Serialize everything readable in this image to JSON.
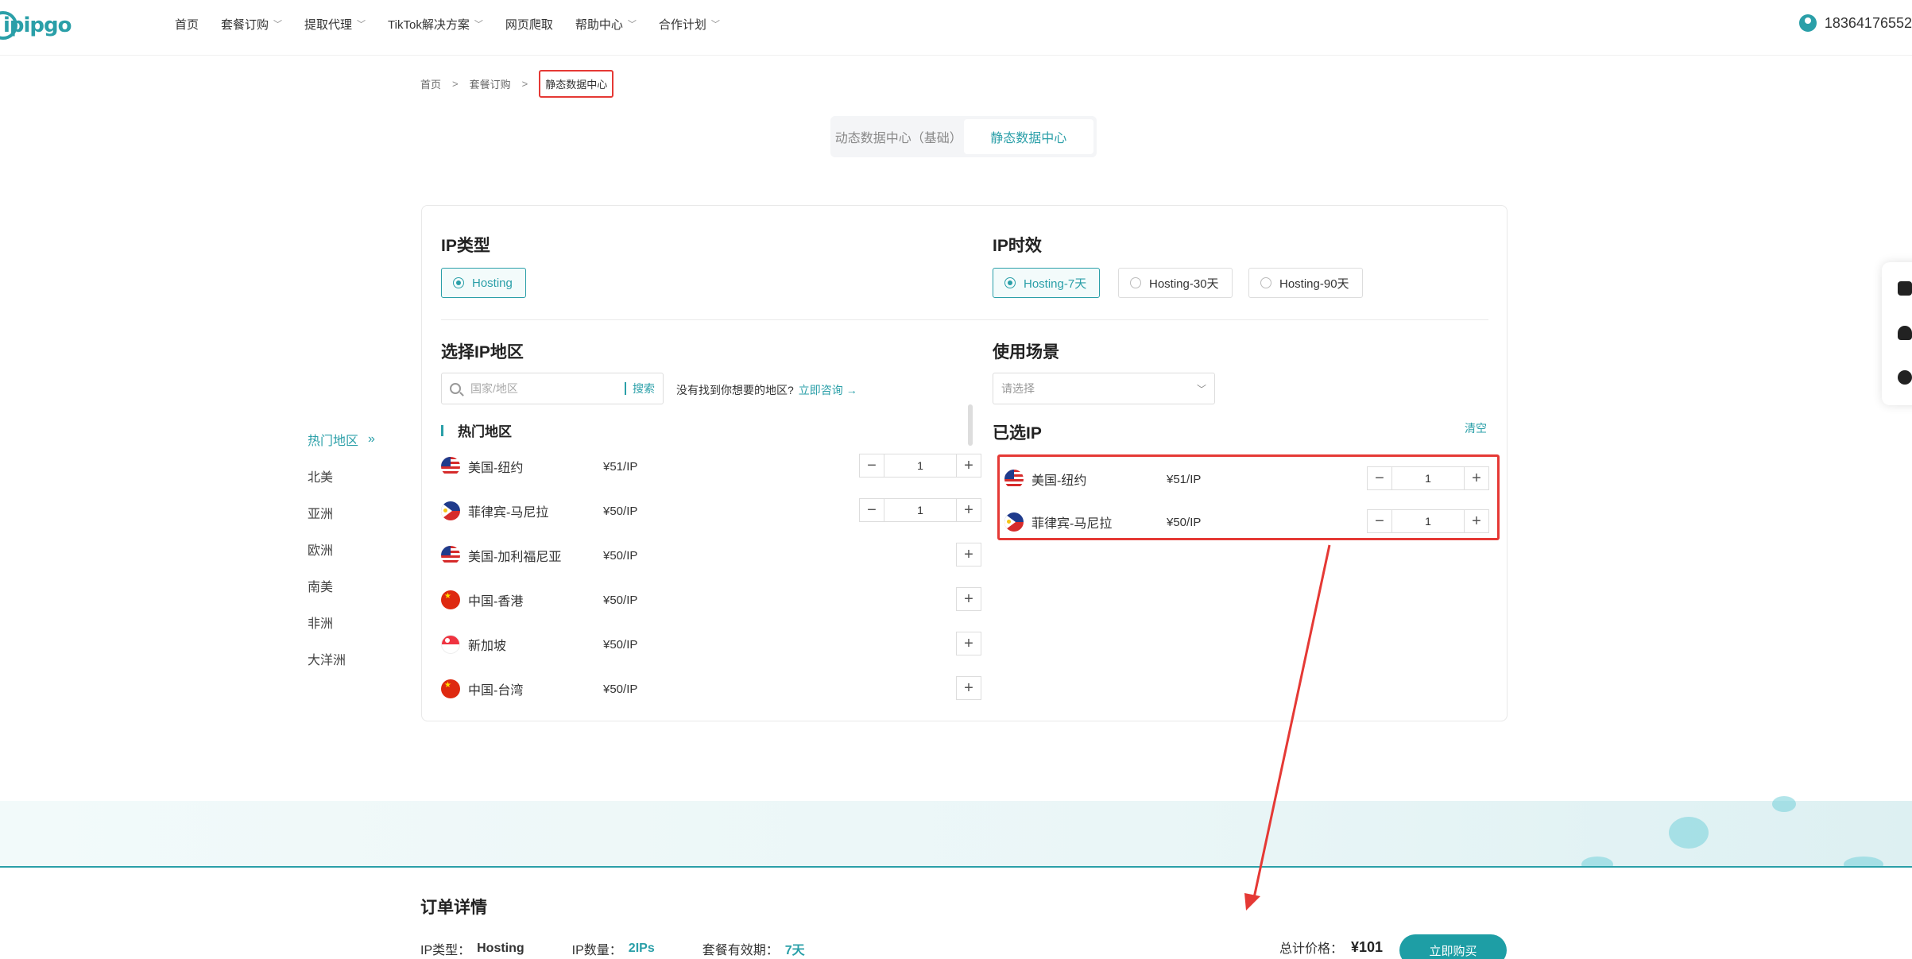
{
  "header": {
    "logo": "ipipgo",
    "nav": [
      {
        "label": "首页",
        "dropdown": false
      },
      {
        "label": "套餐订购",
        "dropdown": true
      },
      {
        "label": "提取代理",
        "dropdown": true
      },
      {
        "label": "TikTok解决方案",
        "dropdown": true
      },
      {
        "label": "网页爬取",
        "dropdown": false
      },
      {
        "label": "帮助中心",
        "dropdown": true
      },
      {
        "label": "合作计划",
        "dropdown": true
      }
    ],
    "user_phone": "18364176552"
  },
  "breadcrumb": {
    "home": "首页",
    "sep": ">",
    "middle": "套餐订购",
    "current": "静态数据中心"
  },
  "tabs": [
    {
      "label": "动态数据中心（基础）",
      "active": false
    },
    {
      "label": "静态数据中心",
      "active": true
    }
  ],
  "regions": [
    {
      "label": "热门地区",
      "active": true
    },
    {
      "label": "北美",
      "active": false
    },
    {
      "label": "亚洲",
      "active": false
    },
    {
      "label": "欧洲",
      "active": false
    },
    {
      "label": "南美",
      "active": false
    },
    {
      "label": "非洲",
      "active": false
    },
    {
      "label": "大洋洲",
      "active": false
    }
  ],
  "ip_type": {
    "title": "IP类型",
    "options": [
      {
        "label": "Hosting",
        "selected": true
      }
    ]
  },
  "ip_duration": {
    "title": "IP时效",
    "options": [
      {
        "label": "Hosting-7天",
        "selected": true
      },
      {
        "label": "Hosting-30天",
        "selected": false
      },
      {
        "label": "Hosting-90天",
        "selected": false
      }
    ]
  },
  "region_select": {
    "title": "选择IP地区",
    "search_placeholder": "国家/地区",
    "search_button": "搜索",
    "hint": "没有找到你想要的地区?",
    "consult_link": "立即咨询",
    "hot_title": "热门地区",
    "items": [
      {
        "flag": "us",
        "name": "美国-纽约",
        "price": "¥51/IP",
        "qty": "1",
        "selected": true
      },
      {
        "flag": "ph",
        "name": "菲律宾-马尼拉",
        "price": "¥50/IP",
        "qty": "1",
        "selected": true
      },
      {
        "flag": "us",
        "name": "美国-加利福尼亚",
        "price": "¥50/IP",
        "qty": "",
        "selected": false
      },
      {
        "flag": "cn",
        "name": "中国-香港",
        "price": "¥50/IP",
        "qty": "",
        "selected": false
      },
      {
        "flag": "sg",
        "name": "新加坡",
        "price": "¥50/IP",
        "qty": "",
        "selected": false
      },
      {
        "flag": "cn",
        "name": "中国-台湾",
        "price": "¥50/IP",
        "qty": "",
        "selected": false
      }
    ]
  },
  "usage": {
    "title": "使用场景",
    "placeholder": "请选择"
  },
  "selected_ips": {
    "title": "已选IP",
    "clear": "清空",
    "items": [
      {
        "flag": "us",
        "name": "美国-纽约",
        "price": "¥51/IP",
        "qty": "1"
      },
      {
        "flag": "ph",
        "name": "菲律宾-马尼拉",
        "price": "¥50/IP",
        "qty": "1"
      }
    ]
  },
  "order": {
    "title": "订单详情",
    "ip_type_label": "IP类型：",
    "ip_type_value": "Hosting",
    "ip_count_label": "IP数量：",
    "ip_count_value": "2IPs",
    "validity_label": "套餐有效期：",
    "validity_value": "7天",
    "total_label": "总计价格：",
    "total_value": "¥101",
    "buy_label": "立即购买"
  },
  "colors": {
    "accent": "#2a9fa8",
    "highlight": "#e53935"
  }
}
